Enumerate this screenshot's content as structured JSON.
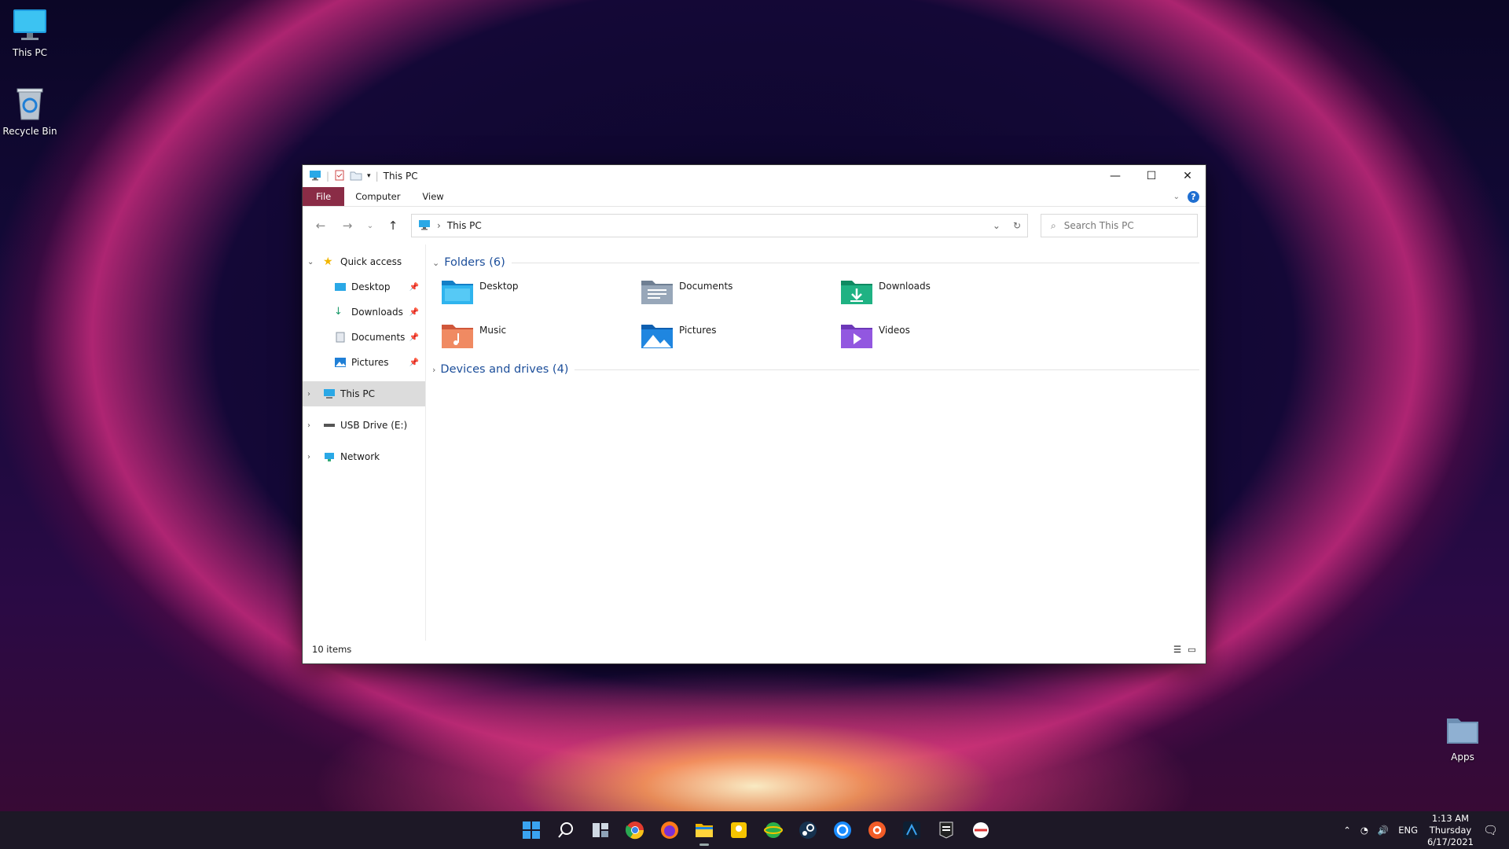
{
  "desktop": {
    "icons": [
      {
        "label": "This PC"
      },
      {
        "label": "Recycle Bin"
      },
      {
        "label": "Apps"
      }
    ]
  },
  "window": {
    "title": "This PC",
    "ribbon": {
      "tabs": [
        "File",
        "Computer",
        "View"
      ]
    },
    "address": {
      "location": "This PC"
    },
    "search": {
      "placeholder": "Search This PC"
    },
    "nav": {
      "quick_access": "Quick access",
      "quick_items": [
        "Desktop",
        "Downloads",
        "Documents",
        "Pictures"
      ],
      "this_pc": "This PC",
      "usb": "USB Drive (E:)",
      "network": "Network"
    },
    "groups": {
      "folders_header": "Folders (6)",
      "devices_header": "Devices and drives (4)"
    },
    "folders": [
      "Desktop",
      "Documents",
      "Downloads",
      "Music",
      "Pictures",
      "Videos"
    ],
    "status": "10 items"
  },
  "taskbar": {
    "tray": {
      "language": "ENG",
      "time": "1:13 AM",
      "day": "Thursday",
      "date": "6/17/2021"
    }
  }
}
